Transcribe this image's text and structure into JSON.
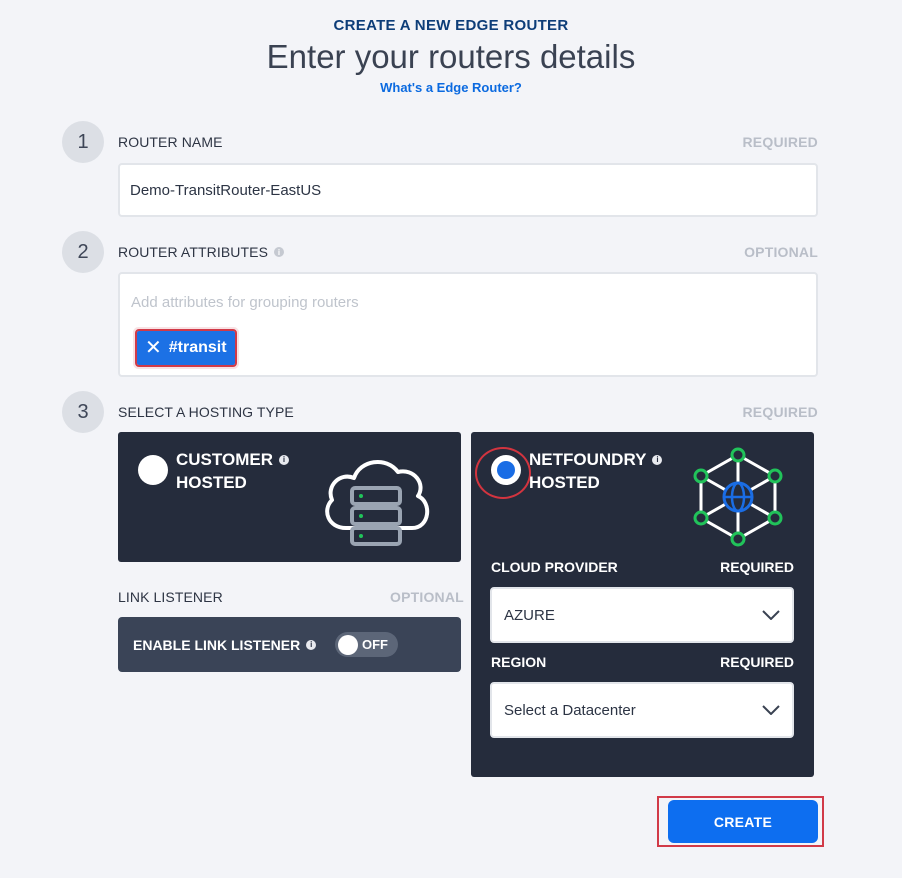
{
  "header": {
    "kicker": "CREATE A NEW EDGE ROUTER",
    "title": "Enter your routers details",
    "help_link": "What's a Edge Router?"
  },
  "steps": [
    {
      "number": "1",
      "label": "ROUTER NAME",
      "requirement": "REQUIRED"
    },
    {
      "number": "2",
      "label": "ROUTER ATTRIBUTES",
      "requirement": "OPTIONAL"
    },
    {
      "number": "3",
      "label": "SELECT A HOSTING TYPE",
      "requirement": "REQUIRED"
    }
  ],
  "router_name": {
    "value": "Demo-TransitRouter-EastUS"
  },
  "router_attributes": {
    "placeholder": "Add attributes for grouping routers",
    "chips": [
      {
        "label": "#transit",
        "remove_icon": "close-icon"
      }
    ]
  },
  "hosting": {
    "customer": {
      "line1": "CUSTOMER",
      "line2": "HOSTED",
      "selected": false,
      "icon": "cloud-server-icon"
    },
    "netfoundry": {
      "line1": "NETFOUNDRY",
      "line2": "HOSTED",
      "selected": true,
      "icon": "network-globe-icon",
      "cloud_provider": {
        "label": "CLOUD PROVIDER",
        "requirement": "REQUIRED",
        "value": "AZURE"
      },
      "region": {
        "label": "REGION",
        "requirement": "REQUIRED",
        "value": "Select a Datacenter"
      }
    }
  },
  "link_listener": {
    "label": "LINK LISTENER",
    "requirement": "OPTIONAL",
    "toggle_label": "ENABLE LINK LISTENER",
    "state": "OFF"
  },
  "actions": {
    "create": "CREATE"
  },
  "colors": {
    "kicker": "#0d3d78",
    "link": "#0b6ae0",
    "card_bg": "#252c3c",
    "primary": "#0d6ef0",
    "highlight_border": "#d13a48",
    "node_green": "#21c35a"
  }
}
